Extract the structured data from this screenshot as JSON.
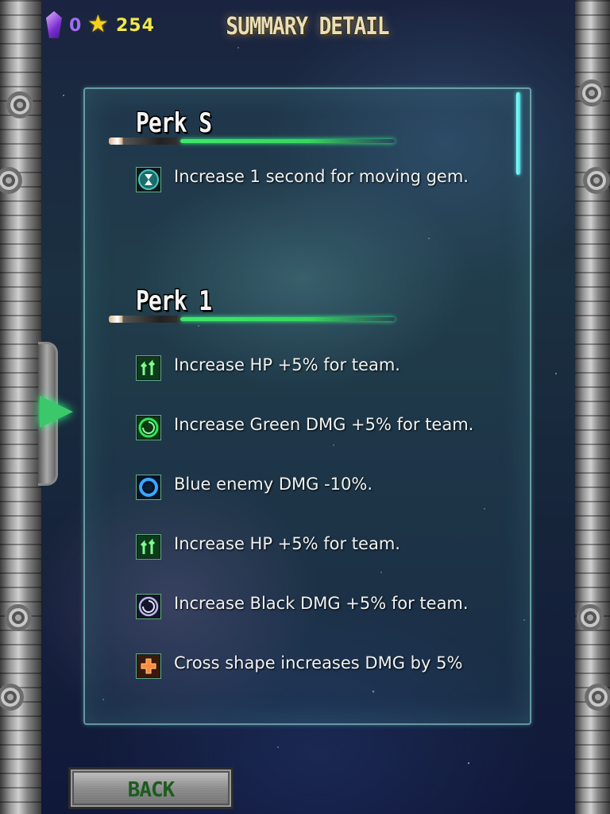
{
  "header": {
    "gem_count": "0",
    "star_count": "254",
    "title": "SUMMARY DETAIL"
  },
  "perks": [
    {
      "heading": "Perk S",
      "items": [
        {
          "icon": "hourglass-icon",
          "text": "Increase 1 second for moving gem."
        }
      ]
    },
    {
      "heading": "Perk 1",
      "items": [
        {
          "icon": "hp-up-arrows-icon",
          "text": "Increase HP +5% for team."
        },
        {
          "icon": "green-swirl-icon",
          "text": "Increase Green DMG +5% for team."
        },
        {
          "icon": "blue-ring-icon",
          "text": "Blue enemy DMG -10%."
        },
        {
          "icon": "hp-up-arrows-icon",
          "text": "Increase HP +5%  for team."
        },
        {
          "icon": "black-swirl-icon",
          "text": "Increase Black DMG +5% for team."
        },
        {
          "icon": "cross-shape-icon",
          "text": "Cross shape increases DMG by 5%"
        }
      ]
    }
  ],
  "back_button": {
    "label": "BACK"
  },
  "colors": {
    "gem_purple": "#9f6df5",
    "star_yellow": "#f1e84a",
    "blade_green": "#3fe86a",
    "panel_border": "#a0f0e6",
    "back_text": "#1c5c20"
  }
}
